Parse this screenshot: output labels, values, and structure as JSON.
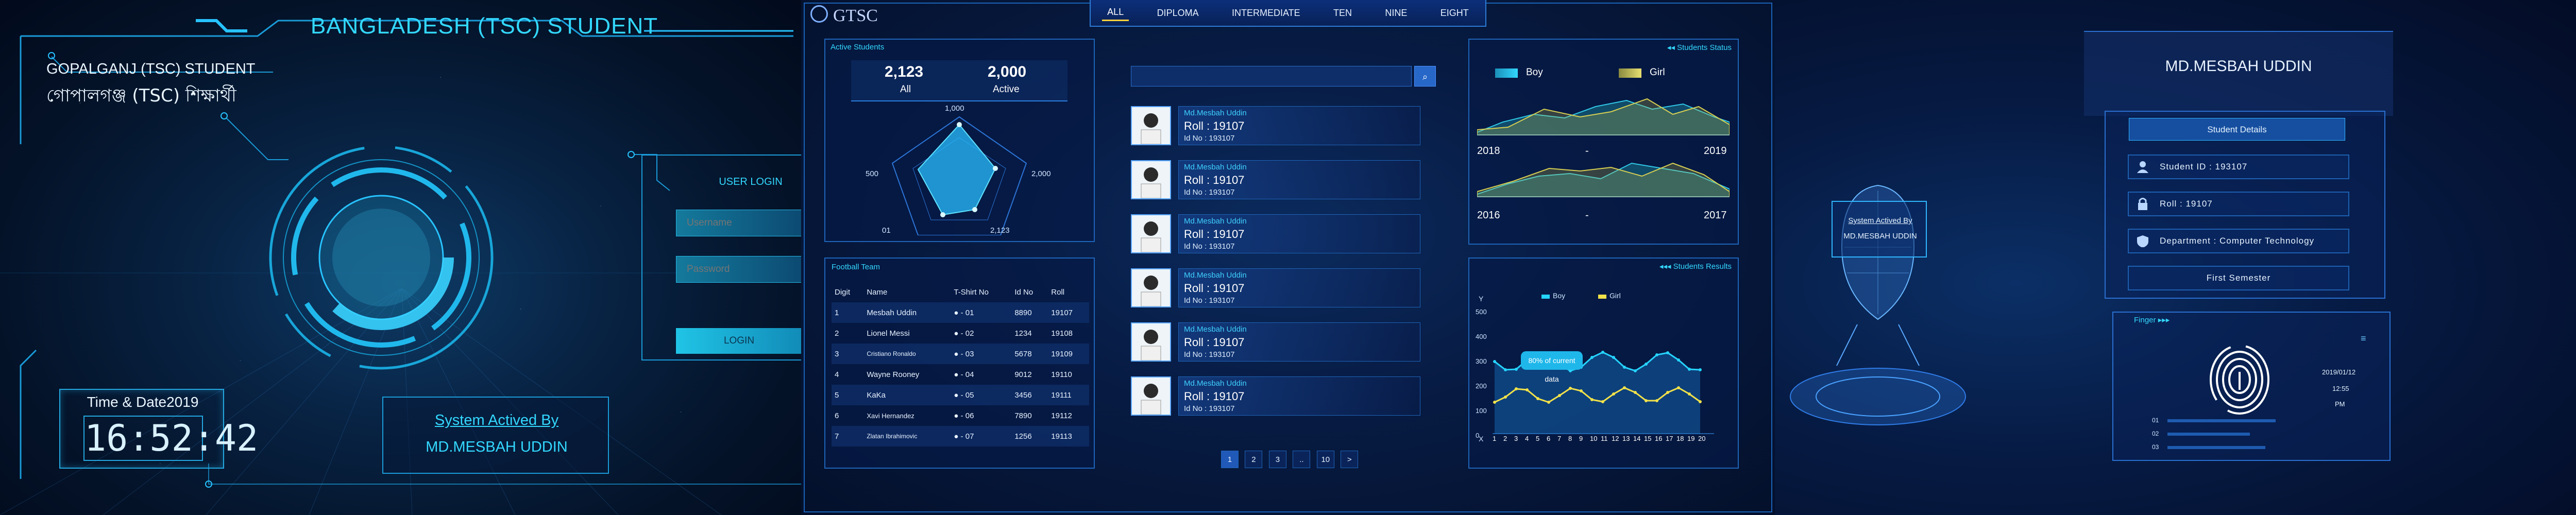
{
  "panel1": {
    "title": "BANGLADESH (TSC) STUDENT",
    "subtitle_en": "GOPALGANJ (TSC) STUDENT",
    "subtitle_bn": "গোপালগঞ্জ (TSC) শিক্ষার্থী",
    "login": {
      "heading": "USER LOGIN",
      "username_placeholder": "Username",
      "password_placeholder": "Password",
      "button": "LOGIN"
    },
    "clock": {
      "label": "Time & Date2019",
      "time": "16:52:42"
    },
    "system": {
      "line1": "System Actived By",
      "line2": "MD.MESBAH UDDIN"
    }
  },
  "panel2": {
    "logo": "GTSC",
    "tabs": [
      "ALL",
      "DIPLOMA",
      "INTERMEDIATE",
      "TEN",
      "NINE",
      "EIGHT"
    ],
    "active_tab": "ALL",
    "active_students": {
      "title": "Active Students",
      "all_value": "2,123",
      "all_label": "All",
      "active_value": "2,000",
      "active_label": "Active",
      "radar_labels": [
        "1,000",
        "2,000",
        "2,123",
        "01",
        "500"
      ]
    },
    "football": {
      "title": "Football Team",
      "headers": [
        "Digit",
        "Name",
        "T-Shirt No",
        "Id No",
        "Roll"
      ],
      "rows": [
        [
          "1",
          "Mesbah Uddin",
          "01",
          "8890",
          "19107"
        ],
        [
          "2",
          "Lionel Messi",
          "02",
          "1234",
          "19108"
        ],
        [
          "3",
          "Cristiano Ronaldo",
          "03",
          "5678",
          "19109"
        ],
        [
          "4",
          "Wayne Rooney",
          "04",
          "9012",
          "19110"
        ],
        [
          "5",
          "KaKa",
          "05",
          "3456",
          "19111"
        ],
        [
          "6",
          "Xavi Hernandez",
          "06",
          "7890",
          "19112"
        ],
        [
          "7",
          "Zlatan Ibrahimovic",
          "07",
          "1256",
          "19113"
        ]
      ]
    },
    "students": [
      {
        "name": "Md.Mesbah Uddin",
        "roll": "Roll : 19107",
        "id": "Id No : 193107"
      },
      {
        "name": "Md.Mesbah Uddin",
        "roll": "Roll : 19107",
        "id": "Id No : 193107"
      },
      {
        "name": "Md.Mesbah Uddin",
        "roll": "Roll : 19107",
        "id": "Id No : 193107"
      },
      {
        "name": "Md.Mesbah Uddin",
        "roll": "Roll : 19107",
        "id": "Id No : 193107"
      },
      {
        "name": "Md.Mesbah Uddin",
        "roll": "Roll : 19107",
        "id": "Id No : 193107"
      },
      {
        "name": "Md.Mesbah Uddin",
        "roll": "Roll : 19107",
        "id": "Id No : 193107"
      }
    ],
    "pagination": [
      "1",
      "2",
      "3",
      "..",
      "10",
      ">"
    ],
    "status": {
      "title": "Students Status",
      "legend_boy": "Boy",
      "legend_girl": "Girl",
      "range1_from": "2018",
      "range1_to": "2019",
      "dash": "-",
      "range2_from": "2016",
      "range2_to": "2017"
    },
    "results": {
      "title": "Students Results",
      "legend_boy": "Boy",
      "legend_girl": "Girl",
      "y_label": "Y",
      "x_label": "X",
      "y_ticks": [
        "500",
        "400",
        "300",
        "200",
        "100",
        "0"
      ],
      "x_ticks": [
        "1",
        "2",
        "3",
        "4",
        "5",
        "6",
        "7",
        "8",
        "9",
        "10",
        "11",
        "12",
        "13",
        "14",
        "15",
        "16",
        "17",
        "18",
        "19",
        "20"
      ],
      "tooltip": "80% of current data"
    },
    "colors": {
      "accent": "#33d8ff",
      "boy": "#25d4ff",
      "girl": "#f2e24a"
    }
  },
  "panel3": {
    "face_text1": "System Actived By",
    "face_text2": "MD.MESBAH UDDIN",
    "name": "MD.MESBAH UDDIN",
    "details_button": "Student Details",
    "student_id": "Student ID : 193107",
    "roll": "Roll : 19107",
    "department": "Department : Computer Technology",
    "semester": "First Semester",
    "finger_title": "Finger",
    "finger_date": "2019/01/12",
    "finger_time": "12:55",
    "finger_meridiem": "PM",
    "finger_bar_labels": [
      "01",
      "02",
      "03"
    ]
  }
}
